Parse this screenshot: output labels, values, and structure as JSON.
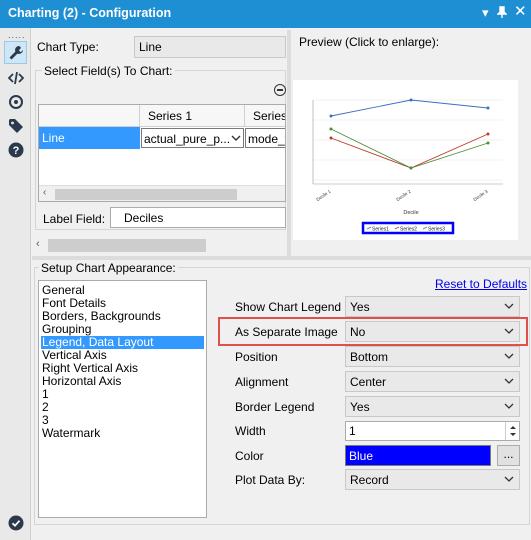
{
  "window": {
    "title": "Charting (2) - Configuration"
  },
  "rail": {
    "dots": "....."
  },
  "chart_type": {
    "label": "Chart Type:",
    "value": "Line"
  },
  "select_fields": {
    "title": "Select Field(s) To Chart:",
    "columns": [
      "",
      "Series 1",
      "Series"
    ],
    "row": {
      "name": "Line",
      "series1": "actual_pure_p...",
      "series2": "mode_w"
    }
  },
  "label_field": {
    "label": "Label Field:",
    "value": "Deciles"
  },
  "preview": {
    "title": "Preview (Click to enlarge):",
    "categories": [
      "Decile 1",
      "Decile 2",
      "Decile 3"
    ],
    "xlabel": "Decile",
    "legend": [
      "Series1",
      "Series2",
      "Series3"
    ],
    "colors": [
      "#3a6fc4",
      "#c0392b",
      "#4d8f3a"
    ]
  },
  "appearance": {
    "title": "Setup Chart Appearance:",
    "reset_label": "Reset to Defaults",
    "list": [
      "General",
      "Font Details",
      "Borders, Backgrounds",
      "Grouping",
      "Legend, Data Layout",
      "Vertical Axis",
      "Right Vertical Axis",
      "Horizontal Axis",
      "1",
      "2",
      "3",
      "Watermark"
    ],
    "selected_index": 4
  },
  "settings": {
    "show_legend": {
      "label": "Show Chart Legend",
      "value": "Yes"
    },
    "separate_image": {
      "label": "As Separate Image",
      "value": "No"
    },
    "position": {
      "label": "Position",
      "value": "Bottom"
    },
    "alignment": {
      "label": "Alignment",
      "value": "Center"
    },
    "border_legend": {
      "label": "Border Legend",
      "value": "Yes"
    },
    "width": {
      "label": "Width",
      "value": "1"
    },
    "color": {
      "label": "Color",
      "value": "Blue",
      "swatch": "#0000ff",
      "button": "..."
    },
    "plot_by": {
      "label": "Plot Data By:",
      "value": "Record"
    }
  },
  "colors": {
    "accent": "#1f8fd3",
    "highlight": "#e0504a",
    "selection": "#3399ff"
  }
}
